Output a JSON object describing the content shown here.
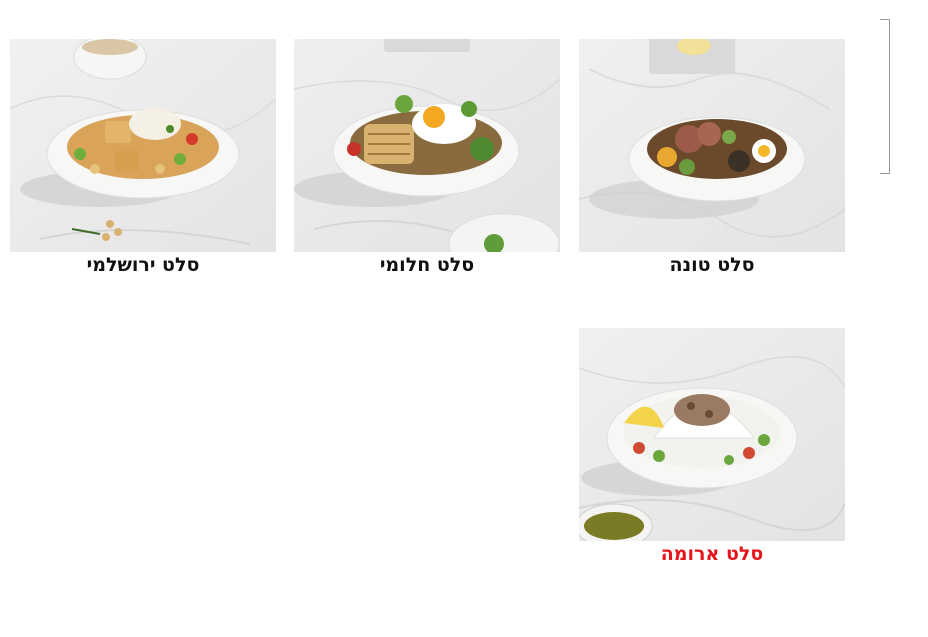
{
  "menu": {
    "items": [
      {
        "id": "tuna",
        "label": "סלט טונה",
        "image": "tuna-salad-bowl",
        "selected": false
      },
      {
        "id": "halloumi",
        "label": "סלט חלומי",
        "image": "halloumi-salad-bowl",
        "selected": false
      },
      {
        "id": "jerusalem",
        "label": "סלט ירושלמי",
        "image": "jerusalem-salad-bowl",
        "selected": false
      },
      {
        "id": "aroma",
        "label": "סלט ארומה",
        "image": "aroma-salad-bowl",
        "selected": true
      }
    ]
  },
  "colors": {
    "selected_label": "#e8141b",
    "label": "#111111",
    "marble": "#ececec",
    "bowl": "#f7f7f5"
  }
}
